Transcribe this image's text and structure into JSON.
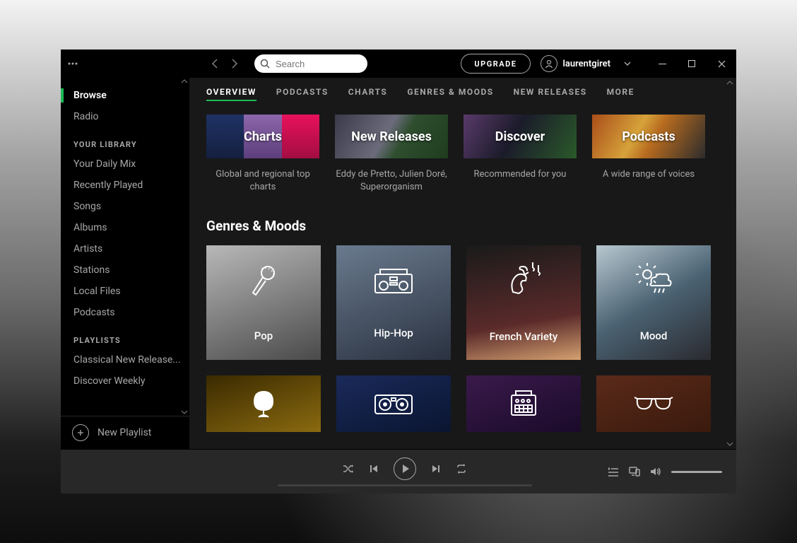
{
  "titlebar": {
    "search_placeholder": "Search",
    "upgrade_label": "UPGRADE",
    "username": "laurentgiret"
  },
  "sidebar": {
    "nav": [
      {
        "label": "Browse",
        "active": true
      },
      {
        "label": "Radio",
        "active": false
      }
    ],
    "library_header": "YOUR LIBRARY",
    "library": [
      {
        "label": "Your Daily Mix"
      },
      {
        "label": "Recently Played"
      },
      {
        "label": "Songs"
      },
      {
        "label": "Albums"
      },
      {
        "label": "Artists"
      },
      {
        "label": "Stations"
      },
      {
        "label": "Local Files"
      },
      {
        "label": "Podcasts"
      }
    ],
    "playlists_header": "PLAYLISTS",
    "playlists": [
      {
        "label": "Classical New Release..."
      },
      {
        "label": "Discover Weekly"
      }
    ],
    "new_playlist_label": "New Playlist"
  },
  "tabs": [
    {
      "label": "OVERVIEW",
      "active": true
    },
    {
      "label": "PODCASTS",
      "active": false
    },
    {
      "label": "CHARTS",
      "active": false
    },
    {
      "label": "GENRES & MOODS",
      "active": false
    },
    {
      "label": "NEW RELEASES",
      "active": false
    },
    {
      "label": "MORE",
      "active": false
    }
  ],
  "hero_tiles": [
    {
      "title": "Charts",
      "subtitle": "Global and regional top charts"
    },
    {
      "title": "New Releases",
      "subtitle": "Eddy de Pretto, Julien Doré, Superorganism"
    },
    {
      "title": "Discover",
      "subtitle": "Recommended for you"
    },
    {
      "title": "Podcasts",
      "subtitle": "A wide range of voices"
    }
  ],
  "section_title": "Genres & Moods",
  "genres": [
    {
      "label": "Pop"
    },
    {
      "label": "Hip-Hop"
    },
    {
      "label": "French Variety"
    },
    {
      "label": "Mood"
    }
  ]
}
